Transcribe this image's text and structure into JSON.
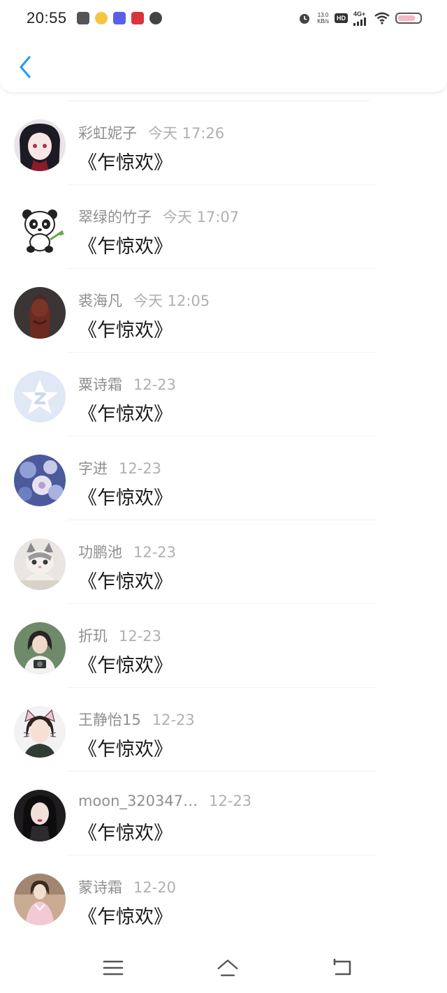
{
  "status_bar": {
    "time": "20:55",
    "net_speed_value": "13.0",
    "net_speed_unit": "KB/s",
    "hd_label": "HD",
    "network_type": "4G+",
    "notification_icons": [
      "app-icon-1",
      "app-icon-2",
      "app-icon-3",
      "app-icon-4",
      "app-icon-5"
    ]
  },
  "header": {
    "back_icon": "chevron-left-icon"
  },
  "colors": {
    "accent": "#2b9af3",
    "name_text": "#8f8f8f",
    "time_text": "#b0b0b0",
    "message_text": "#1a1a1a"
  },
  "messages": [
    {
      "name": "彩虹妮子",
      "time": "今天 17:26",
      "text": "《乍惊欢》",
      "avatar": "anime-girl-avatar"
    },
    {
      "name": "翠绿的竹子",
      "time": "今天 17:07",
      "text": "《乍惊欢》",
      "avatar": "panda-avatar"
    },
    {
      "name": "裘海凡",
      "time": "今天 12:05",
      "text": "《乍惊欢》",
      "avatar": "statue-avatar"
    },
    {
      "name": "粟诗霜",
      "time": "12-23",
      "text": "《乍惊欢》",
      "avatar": "default-star-avatar"
    },
    {
      "name": "字进",
      "time": "12-23",
      "text": "《乍惊欢》",
      "avatar": "flower-avatar"
    },
    {
      "name": "功鹏池",
      "time": "12-23",
      "text": "《乍惊欢》",
      "avatar": "kitten-avatar"
    },
    {
      "name": "折玑",
      "time": "12-23",
      "text": "《乍惊欢》",
      "avatar": "girl-camera-avatar"
    },
    {
      "name": "王静怡15",
      "time": "12-23",
      "text": "《乍惊欢》",
      "avatar": "cat-ears-girl-avatar"
    },
    {
      "name": "moon_320347…",
      "time": "12-23",
      "text": "《乍惊欢》",
      "avatar": "dark-hair-girl-avatar"
    },
    {
      "name": "蒙诗霜",
      "time": "12-20",
      "text": "《乍惊欢》",
      "avatar": "pink-dress-girl-avatar"
    }
  ],
  "nav_bar": {
    "menu_icon": "menu-icon",
    "home_icon": "home-icon",
    "back_icon": "back-arrow-icon"
  }
}
